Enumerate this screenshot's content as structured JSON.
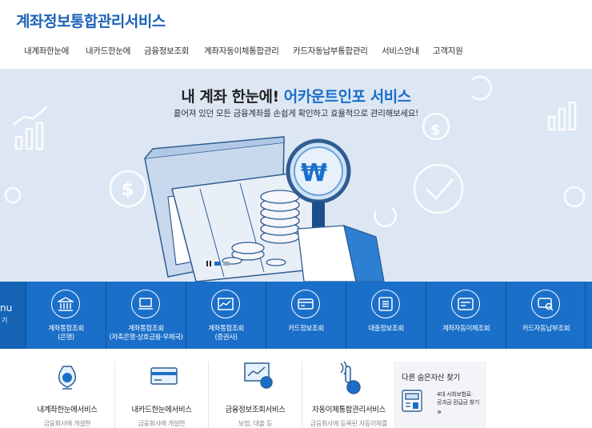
{
  "header": {
    "logo": "계좌정보통합관리서비스",
    "nav": [
      "내계좌한눈에",
      "내카드한눈에",
      "금융정보조회",
      "계좌자동이체통합관리",
      "카드자동납부통합관리",
      "서비스안내",
      "고객지원"
    ]
  },
  "hero": {
    "title_prefix": "내 계좌 한눈에! ",
    "title_accent": "어카운트인포 서비스",
    "subtitle": "흩어져 있던 모든 금융계좌를 손쉽게 확인하고 효율적으로 관리해보세요!"
  },
  "quickmenu": {
    "side_label": "nu",
    "side_sub": "기",
    "items": [
      {
        "label": "계좌통합조회\n(은행)",
        "icon": "bank-icon"
      },
      {
        "label": "계좌통합조회\n(저축은행·상호금융·우체국)",
        "icon": "laptop-icon"
      },
      {
        "label": "계좌통합조회\n(증권사)",
        "icon": "stock-chart-icon"
      },
      {
        "label": "카드정보조회",
        "icon": "card-icon"
      },
      {
        "label": "대출정보조회",
        "icon": "document-icon"
      },
      {
        "label": "계좌자동이체조회",
        "icon": "transfer-icon"
      },
      {
        "label": "카드자동납부조회",
        "icon": "card-search-icon"
      }
    ]
  },
  "services": [
    {
      "name": "내계좌한눈에서비스",
      "desc": "금융회사에 개설한",
      "icon": "money-bag-icon"
    },
    {
      "name": "내카드한눈에서비스",
      "desc": "금융회사에 개설한",
      "icon": "card-icon"
    },
    {
      "name": "금융정보조회서비스",
      "desc": "보험, 대출 등",
      "icon": "chart-monitor-icon"
    },
    {
      "name": "자동이체통합관리서비스",
      "desc": "금융회사에 등록된 자동이체를",
      "icon": "hand-coin-icon"
    }
  ],
  "side_panel": {
    "title": "다른 숨은자산 찾기",
    "link": "4대 사회보험료·\n공과금 환급금 찾기",
    "arrow": "»",
    "icon": "atm-icon"
  },
  "colors": {
    "brand": "#1a63b8",
    "bar": "#1a6fc9",
    "hero_bg": "#dde7f3"
  }
}
